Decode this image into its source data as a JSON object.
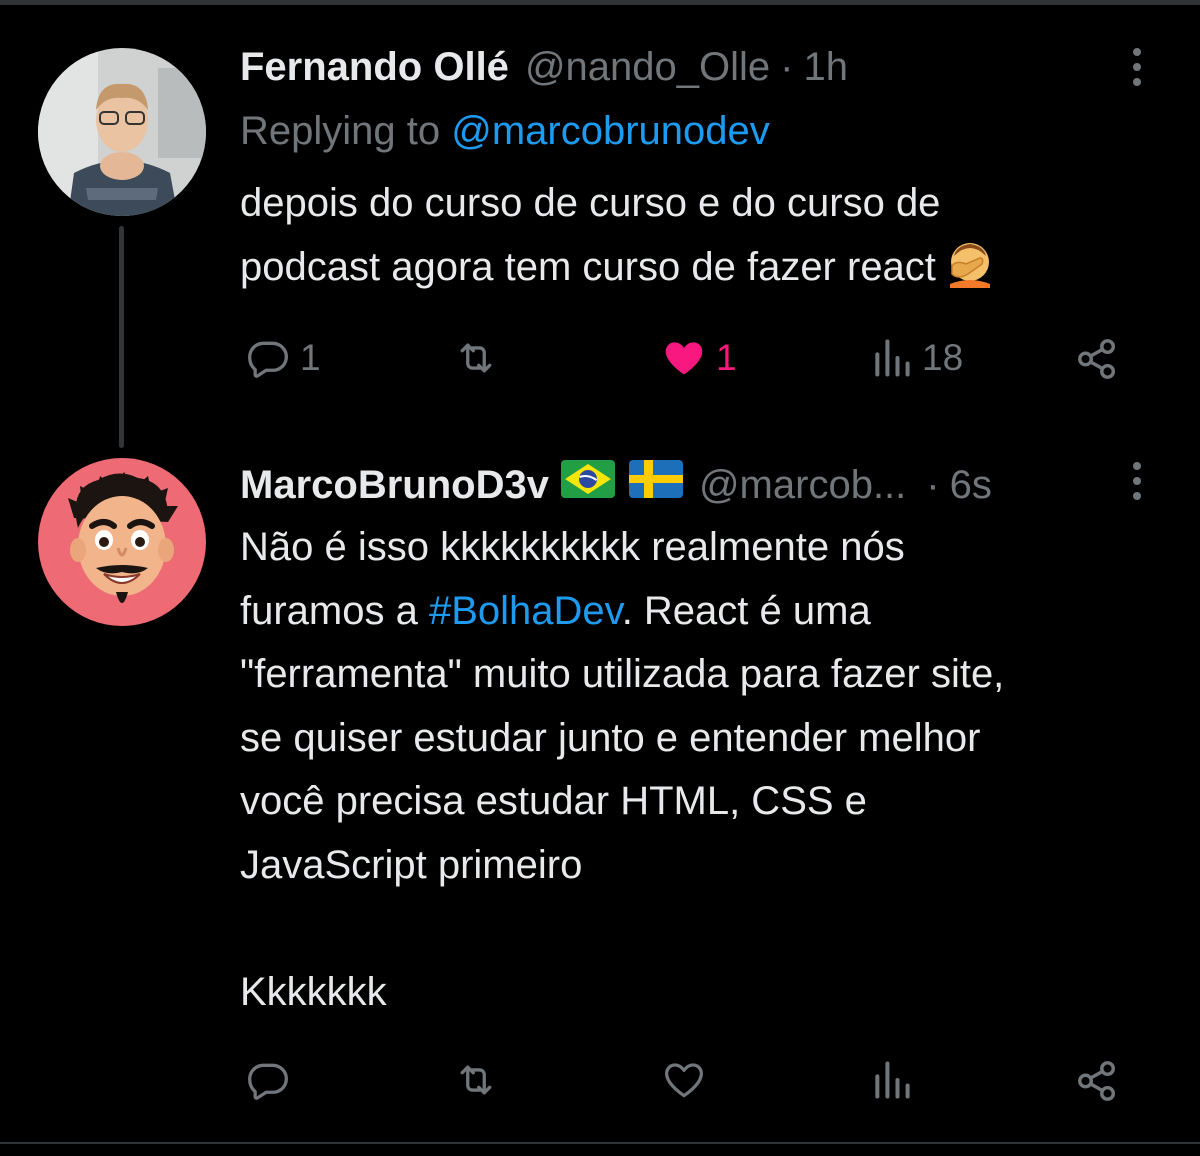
{
  "colors": {
    "background": "#000000",
    "text_primary": "#e7e9ea",
    "text_secondary": "#71767b",
    "link": "#1d9bf0",
    "like_active": "#f91880"
  },
  "tweet1": {
    "author_name": "Fernando Ollé",
    "handle": "@nando_Olle",
    "separator": "·",
    "time": "1h",
    "replying_prefix": "Replying to",
    "replying_handle": "@marcobrunodev",
    "text_lines": [
      "depois do curso de curso e do curso de",
      "podcast agora tem curso de fazer react"
    ],
    "emoji": "facepalm-emoji",
    "actions": {
      "reply_icon": "reply-icon",
      "reply_count": "1",
      "retweet_icon": "retweet-icon",
      "retweet_count": "",
      "like_icon": "heart-filled-icon",
      "like_count": "1",
      "views_icon": "views-icon",
      "views_count": "18",
      "share_icon": "share-icon"
    }
  },
  "tweet2": {
    "author_name": "MarcoBrunoD3v",
    "flags": [
      "brazil-flag",
      "sweden-flag"
    ],
    "handle": "@marcob...",
    "separator": "·",
    "time": "6s",
    "text_lines": [
      {
        "pre": "Não é isso kkkkkkkkkk realmente nós",
        "link": "",
        "post": ""
      },
      {
        "pre": "furamos a ",
        "link": "#BolhaDev",
        "post": ". React é uma"
      },
      {
        "pre": "\"ferramenta\" muito utilizada para fazer site,",
        "link": "",
        "post": ""
      },
      {
        "pre": "se quiser estudar junto e entender melhor",
        "link": "",
        "post": ""
      },
      {
        "pre": "você precisa estudar HTML, CSS e",
        "link": "",
        "post": ""
      },
      {
        "pre": "JavaScript primeiro",
        "link": "",
        "post": ""
      },
      {
        "pre": "",
        "link": "",
        "post": ""
      },
      {
        "pre": "Kkkkkkk",
        "link": "",
        "post": ""
      }
    ],
    "actions": {
      "reply_icon": "reply-icon",
      "reply_count": "",
      "retweet_icon": "retweet-icon",
      "retweet_count": "",
      "like_icon": "heart-outline-icon",
      "like_count": "",
      "views_icon": "views-icon",
      "views_count": "",
      "share_icon": "share-icon"
    }
  }
}
